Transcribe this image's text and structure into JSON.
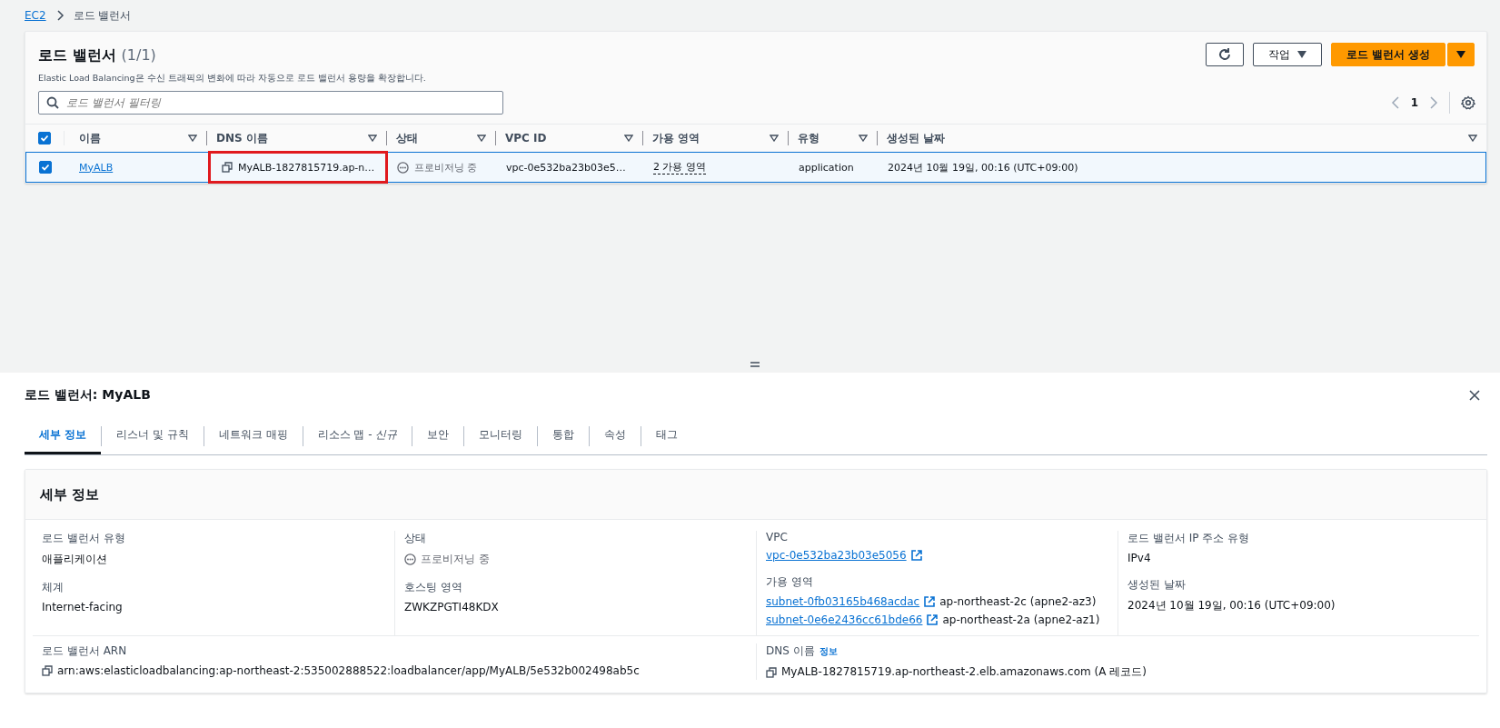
{
  "breadcrumb": [
    {
      "label": "EC2",
      "kind": "link"
    },
    {
      "label": "로드 밸런서",
      "kind": "text"
    }
  ],
  "list_panel": {
    "title": "로드 밸런서",
    "count": "(1/1)",
    "description": "Elastic Load Balancing은 수신 트래픽의 변화에 따라 자동으로 로드 밸런서 용량을 확장합니다.",
    "filter": {
      "placeholder": "로드 밸런서 필터링"
    },
    "actions_button": "작업",
    "create_button": "로드 밸런서 생성",
    "page": "1"
  },
  "table": {
    "all_checked": true,
    "columns": [
      "이름",
      "DNS 이름",
      "상태",
      "VPC ID",
      "가용 영역",
      "유형",
      "생성된 날짜"
    ],
    "rows": [
      {
        "selected": true,
        "name": "MyALB",
        "dns": "MyALB-1827815719.ap-n…",
        "dns_highlighted": true,
        "state": "프로비저닝 중",
        "vpc_id": "vpc-0e532ba23b03e5…",
        "az": "2 가용 영역",
        "type": "application",
        "created": "2024년 10월 19일, 00:16 (UTC+09:00)"
      }
    ]
  },
  "detail": {
    "title": "로드 밸런서: MyALB",
    "tabs": [
      {
        "label": "세부 정보",
        "selected": true
      },
      {
        "label": "리스너 및 규칙",
        "selected": false
      },
      {
        "label": "네트워크 매핑",
        "selected": false
      },
      {
        "label": "리소스 맵 - *신규*",
        "selected": false
      },
      {
        "label": "보안",
        "selected": false
      },
      {
        "label": "모니터링",
        "selected": false
      },
      {
        "label": "통합",
        "selected": false
      },
      {
        "label": "속성",
        "selected": false
      },
      {
        "label": "태그",
        "selected": false
      }
    ],
    "section_title": "세부 정보",
    "columns": [
      [
        {
          "label": "로드 밸런서 유형",
          "values": [
            {
              "text": "애플리케이션",
              "kind": "text"
            }
          ]
        },
        {
          "label": "체계",
          "values": [
            {
              "text": "Internet-facing",
              "kind": "text"
            }
          ]
        }
      ],
      [
        {
          "label": "상태",
          "values": [
            {
              "text": "프로비저닝 중",
              "kind": "status"
            }
          ]
        },
        {
          "label": "호스팅 영역",
          "values": [
            {
              "text": "ZWKZPGTI48KDX",
              "kind": "text"
            }
          ]
        }
      ],
      [
        {
          "label": "VPC",
          "values": [
            {
              "text": "vpc-0e532ba23b03e5056",
              "kind": "link"
            }
          ]
        },
        {
          "label": "가용 영역",
          "values": [
            {
              "text": "subnet-0fb03165b468acdac",
              "kind": "link",
              "note": "ap-northeast-2c (apne2-az3)"
            },
            {
              "text": "subnet-0e6e2436cc61bde66",
              "kind": "link",
              "note": "ap-northeast-2a (apne2-az1)"
            }
          ]
        }
      ],
      [
        {
          "label": "로드 밸런서 IP 주소 유형",
          "values": [
            {
              "text": "IPv4",
              "kind": "text"
            }
          ]
        },
        {
          "label": "생성된 날짜",
          "values": [
            {
              "text": "2024년 10월 19일, 00:16 (UTC+09:00)",
              "kind": "text"
            }
          ]
        }
      ]
    ],
    "arn": {
      "label": "로드 밸런서 ARN",
      "value": "arn:aws:elasticloadbalancing:ap-northeast-2:535002888522:loadbalancer/app/MyALB/5e532b002498ab5c"
    },
    "dns": {
      "label": "DNS 이름",
      "info": "정보",
      "value": "MyALB-1827815719.ap-northeast-2.elb.amazonaws.com (A 레코드)"
    }
  }
}
